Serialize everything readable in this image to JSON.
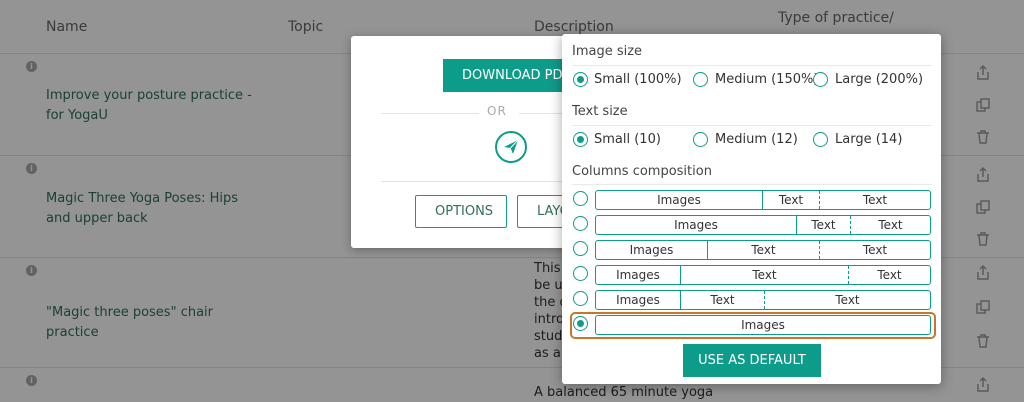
{
  "table": {
    "headers": {
      "name": "Name",
      "topic": "Topic",
      "description": "Description",
      "type": "Type of practice/"
    },
    "rows": [
      {
        "name": "Improve your posture practice - for YogaU",
        "description": ""
      },
      {
        "name": "Magic Three Yoga Poses: Hips and upper back",
        "description": ""
      },
      {
        "name": "\"Magic three poses\" chair practice",
        "description_lines": [
          "This s",
          "be us",
          "the c",
          "intro",
          "stude",
          "as a v"
        ]
      },
      {
        "name": "",
        "description": "A balanced 65 minute yoga"
      }
    ]
  },
  "export_modal": {
    "download_pdf": "DOWNLOAD PDF",
    "or": "OR",
    "options": "OPTIONS",
    "layout": "LAYO"
  },
  "options_panel": {
    "image_size": {
      "label": "Image size",
      "options": [
        "Small (100%)",
        "Medium (150%)",
        "Large (200%)"
      ],
      "selected": 0
    },
    "text_size": {
      "label": "Text size",
      "options": [
        "Small (10)",
        "Medium (12)",
        "Large (14)"
      ],
      "selected": 0
    },
    "columns": {
      "label": "Columns composition",
      "selected": 5,
      "compositions": [
        [
          "Images",
          "Text",
          "Text"
        ],
        [
          "Images",
          "Text",
          "Text"
        ],
        [
          "Images",
          "Text",
          "Text"
        ],
        [
          "Images",
          "Text",
          "Text"
        ],
        [
          "Images",
          "Text",
          "Text"
        ],
        [
          "Images"
        ]
      ]
    },
    "use_default": "USE AS DEFAULT"
  },
  "colors": {
    "accent": "#0e9c8a",
    "highlight": "#c8772a"
  },
  "icons": [
    "info-icon",
    "share-icon",
    "copy-icon",
    "trash-icon",
    "send-icon"
  ]
}
